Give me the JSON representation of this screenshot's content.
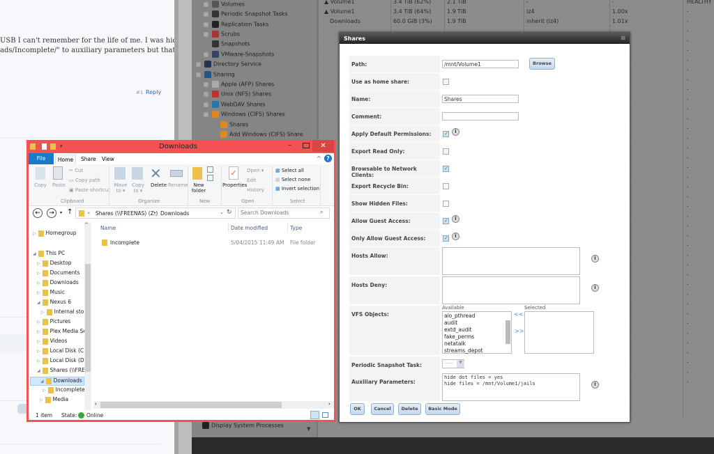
{
  "forum": {
    "line1": "USB I can't remember for the life of me. I was hiding",
    "line2": "ads/Incomplete/\" to auxiliary parameters but that",
    "post_num": "#1",
    "reply": "Reply"
  },
  "nav_tree": [
    {
      "label": "Volumes",
      "expander": "+"
    },
    {
      "label": "Periodic Snapshot Tasks",
      "expander": "+"
    },
    {
      "label": "Replication Tasks",
      "expander": "+"
    },
    {
      "label": "Scrubs",
      "expander": "+"
    },
    {
      "label": "Snapshots",
      "expander": ""
    },
    {
      "label": "VMware-Snapshots",
      "expander": "+"
    },
    {
      "label": "Directory Service",
      "expander": "+"
    },
    {
      "label": "Sharing",
      "expander": "-"
    },
    {
      "label": "Apple (AFP) Shares",
      "expander": "+"
    },
    {
      "label": "Unix (NFS) Shares",
      "expander": "+"
    },
    {
      "label": "WebDAV Shares",
      "expander": "+"
    },
    {
      "label": "Windows (CIFS) Shares",
      "expander": "-"
    },
    {
      "label": "Shares",
      "expander": ""
    },
    {
      "label": "Add Windows (CIFS) Share",
      "expander": ""
    }
  ],
  "nav_bottom": "Display System Processes",
  "volume_table": {
    "rows": [
      [
        "▲ Volume1",
        "3.4 TiB (62%)",
        "2.1 TiB",
        "-",
        "-",
        "HEALTHY"
      ],
      [
        "▲ Volume1",
        "3.4 TiB (64%)",
        "1.9 TiB",
        "lz4",
        "1.00x",
        "-"
      ],
      [
        "Downloads",
        "60.0 GiB (3%)",
        "1.9 TiB",
        "inherit (lz4)",
        "1.01x",
        "-"
      ]
    ]
  },
  "dialog": {
    "title": "Shares",
    "path_label": "Path:",
    "path_value": "/mnt/Volume1",
    "browse": "Browse",
    "home_label": "Use as home share:",
    "home_checked": false,
    "name_label": "Name:",
    "name_value": "Shares",
    "comment_label": "Comment:",
    "comment_value": "",
    "perm_label": "Apply Default Permissions:",
    "perm_checked": true,
    "ro_label": "Export Read Only:",
    "ro_checked": false,
    "browsable_label": "Browsable to Network Clients:",
    "browsable_checked": true,
    "recycle_label": "Export Recycle Bin:",
    "recycle_checked": false,
    "hidden_label": "Show Hidden Files:",
    "hidden_checked": false,
    "guest_label": "Allow Guest Access:",
    "guest_checked": true,
    "onlyguest_label": "Only Allow Guest Access:",
    "onlyguest_checked": true,
    "hosts_allow_label": "Hosts Allow:",
    "hosts_deny_label": "Hosts Deny:",
    "vfs_label": "VFS Objects:",
    "available": "Available",
    "selected": "Selected",
    "vfs_options": [
      "aio_pthread",
      "audit",
      "extd_audit",
      "fake_perms",
      "netatalk",
      "streams_depot"
    ],
    "add": ">>",
    "remove": "<<",
    "snapshot_label": "Periodic Snapshot Task:",
    "snapshot_value": "------",
    "aux_label": "Auxiliary Parameters:",
    "aux_value": "hide dot files = yes\nhide files = /mnt/Volume1/jails",
    "ok": "OK",
    "cancel": "Cancel",
    "delete": "Delete",
    "basic": "Basic Mode",
    "info": "i"
  },
  "explorer": {
    "title": "Downloads",
    "tabs": [
      "File",
      "Home",
      "Share",
      "View"
    ],
    "clipboard": {
      "copy": "Copy",
      "paste": "Paste",
      "cut": "Cut",
      "copy_path": "Copy path",
      "paste_shortcut": "Paste shortcut",
      "group": "Clipboard"
    },
    "organize": {
      "move": "Move to ▾",
      "copy": "Copy to ▾",
      "delete": "Delete",
      "rename": "Rename",
      "group": "Organize"
    },
    "new": {
      "new_folder": "New folder",
      "group": "New"
    },
    "open": {
      "properties": "Properties",
      "open": "Open ▾",
      "edit": "Edit",
      "history": "History",
      "group": "Open"
    },
    "select": {
      "all": "Select all",
      "none": "Select none",
      "invert": "Invert selection",
      "group": "Select"
    },
    "address": [
      "Shares (\\\\FREENAS) (Z:)",
      "Downloads"
    ],
    "search_placeholder": "Search Downloads",
    "columns": [
      "Name",
      "Date modified",
      "Type"
    ],
    "files": [
      {
        "name": "Incomplete",
        "date": "5/04/2015 11:49 AM",
        "type": "File folder"
      }
    ],
    "nav_items": [
      "Homegroup",
      "This PC",
      "Desktop",
      "Documents",
      "Downloads",
      "Music",
      "Nexus 6",
      "Internal stora",
      "Pictures",
      "Plex Media Se",
      "Videos",
      "Local Disk (C:)",
      "Local Disk (D:)",
      "Shares (\\\\FRE",
      "Downloads",
      "Incomplete",
      "Media"
    ],
    "selected_nav": "Downloads",
    "status_count": "1 item",
    "status_state": "State:",
    "status_online": "Online",
    "accent": "#1979ca",
    "border": "#f25252"
  }
}
